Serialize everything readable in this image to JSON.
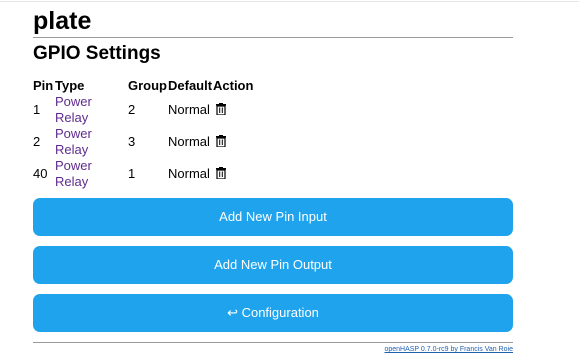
{
  "page": {
    "title": "plate",
    "section_title": "GPIO Settings"
  },
  "table": {
    "headers": {
      "pin": "Pin",
      "type": "Type",
      "group": "Group",
      "default": "Default",
      "action": "Action"
    },
    "rows": [
      {
        "pin": "1",
        "type": "Power Relay",
        "group": "2",
        "default": "Normal",
        "action_icon": "trash-icon"
      },
      {
        "pin": "2",
        "type": "Power Relay",
        "group": "3",
        "default": "Normal",
        "action_icon": "trash-icon"
      },
      {
        "pin": "40",
        "type": "Power Relay",
        "group": "1",
        "default": "Normal",
        "action_icon": "trash-icon"
      }
    ]
  },
  "buttons": {
    "add_input": "Add New Pin Input",
    "add_output": "Add New Pin Output",
    "configuration": "↩ Configuration"
  },
  "footer": {
    "credit": "openHASP 0.7.0-rc9 by Francis Van Roie"
  },
  "colors": {
    "button": "#1fa3ec",
    "link": "#5f2b8e",
    "footer_link": "#1f62b0"
  }
}
